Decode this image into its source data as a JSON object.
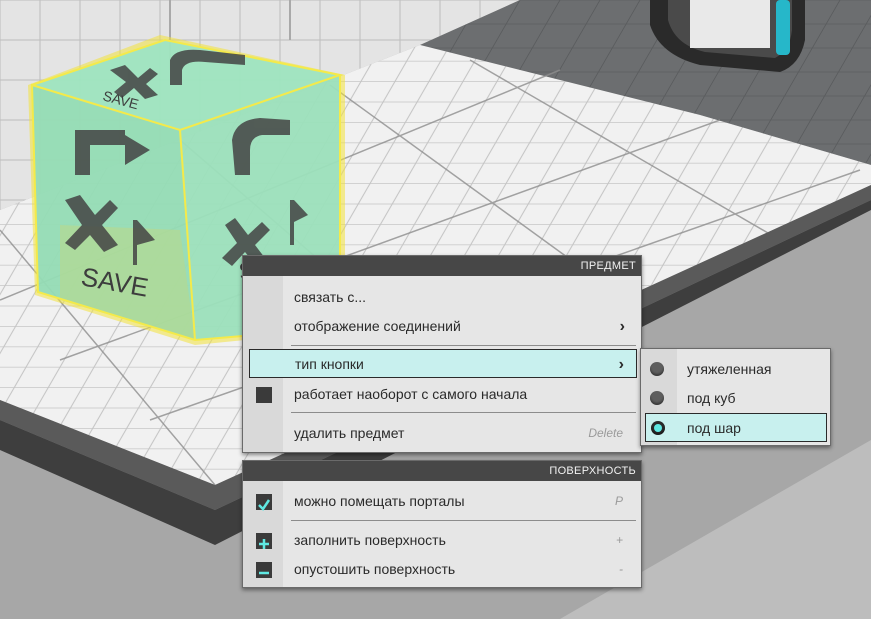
{
  "item_menu": {
    "header": "ПРЕДМЕТ",
    "items": [
      {
        "label": "связать с..."
      },
      {
        "label": "отображение соединений",
        "chevron": "›"
      },
      {
        "label": "тип кнопки",
        "chevron": "›"
      },
      {
        "label": "работает наоборот с самого начала",
        "icon": "checkbox-unchecked-icon"
      },
      {
        "label": "удалить предмет",
        "shortcut": "Delete"
      }
    ]
  },
  "button_type_submenu": {
    "items": [
      {
        "label": "утяжеленная",
        "selected": false
      },
      {
        "label": "под куб",
        "selected": false
      },
      {
        "label": "под шар",
        "selected": true
      }
    ]
  },
  "surface_menu": {
    "header": "ПОВЕРХНОСТЬ",
    "items": [
      {
        "label": "можно помещать порталы",
        "shortcut": "P",
        "icon": "checkbox-checked-icon"
      },
      {
        "label": "заполнить поверхность",
        "shortcut": "+",
        "icon": "plus-icon"
      },
      {
        "label": "опустошить поверхность",
        "shortcut": "-",
        "icon": "minus-icon"
      }
    ]
  },
  "scene": {
    "cube_text": "SAVE",
    "accent": "#5fe8e2",
    "selection_glow": "#f2e23a"
  }
}
